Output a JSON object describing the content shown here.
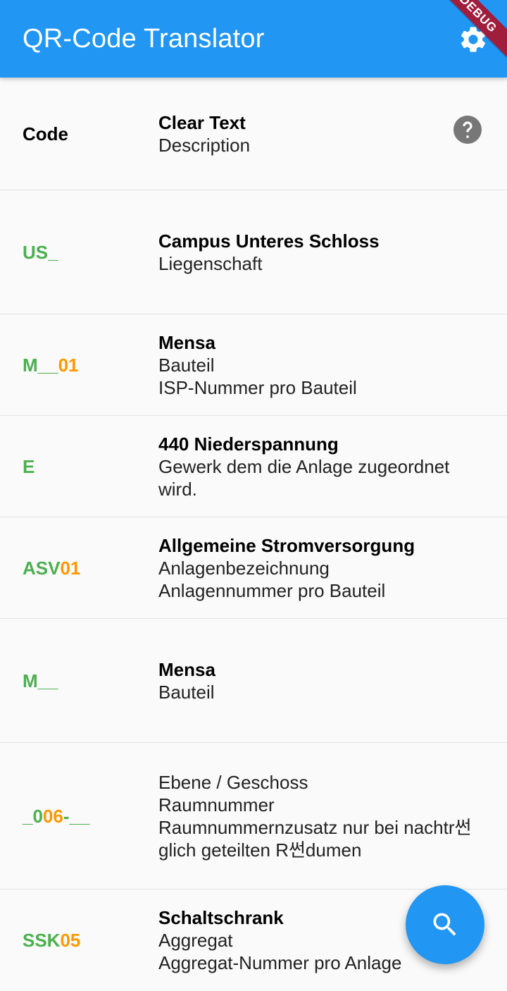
{
  "app_bar": {
    "title": "QR-Code Translator",
    "settings_icon": "gear-icon",
    "debug_banner": "DEBUG",
    "color": "#2196f3"
  },
  "header": {
    "code_label": "Code",
    "clear_text_label": "Clear Text",
    "description_label": "Description",
    "help_icon": "help-circle-icon"
  },
  "colors": {
    "code_green": "#4caf50",
    "code_orange": "#ff9800"
  },
  "rows": [
    {
      "code_parts": [
        {
          "text": "US_",
          "color": "green"
        }
      ],
      "title": "Campus Unteres Schloss",
      "lines": [
        "Liegenschaft"
      ]
    },
    {
      "code_parts": [
        {
          "text": "M__",
          "color": "green"
        },
        {
          "text": "01",
          "color": "orange"
        }
      ],
      "title": "Mensa",
      "lines": [
        "Bauteil",
        "ISP-Nummer pro Bauteil"
      ]
    },
    {
      "code_parts": [
        {
          "text": "E",
          "color": "green"
        }
      ],
      "title": "440 Niederspannung",
      "lines": [
        "Gewerk dem die Anlage zugeordnet wird."
      ]
    },
    {
      "code_parts": [
        {
          "text": "ASV",
          "color": "green"
        },
        {
          "text": "01",
          "color": "orange"
        }
      ],
      "title": "Allgemeine Stromversorgung",
      "lines": [
        "Anlagenbezeichnung",
        "Anlagennummer pro Bauteil"
      ]
    },
    {
      "code_parts": [
        {
          "text": "M__",
          "color": "green"
        }
      ],
      "title": "Mensa",
      "lines": [
        "Bauteil"
      ]
    },
    {
      "code_parts": [
        {
          "text": "_0",
          "color": "green"
        },
        {
          "text": "06",
          "color": "orange"
        },
        {
          "text": "-__",
          "color": "green"
        }
      ],
      "title": "",
      "lines": [
        "Ebene / Geschoss",
        "Raumnummer",
        "Raumnummernzusatz nur bei nachtr썬glich geteilten R썬dumen"
      ]
    },
    {
      "code_parts": [
        {
          "text": "SSK",
          "color": "green"
        },
        {
          "text": "05",
          "color": "orange"
        }
      ],
      "title": "Schaltschrank",
      "lines": [
        "Aggregat",
        "Aggregat-Nummer pro Anlage"
      ]
    }
  ],
  "fab": {
    "icon": "search-icon"
  }
}
